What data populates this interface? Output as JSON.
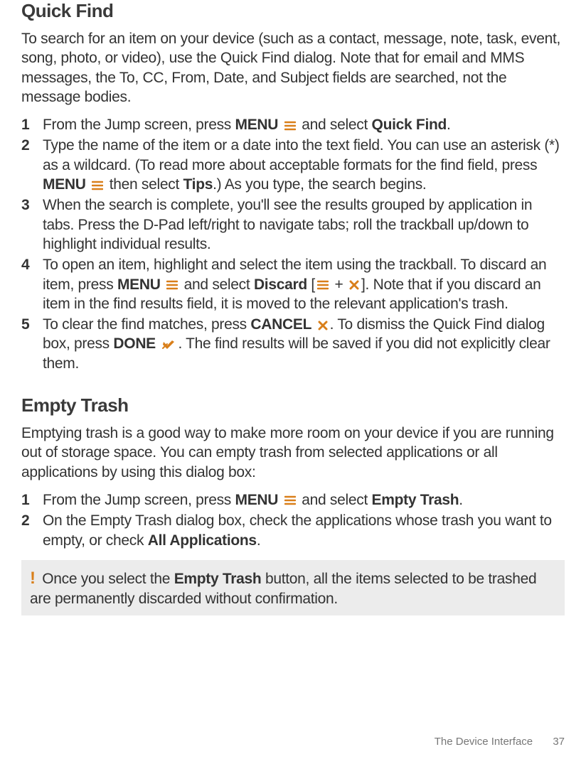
{
  "section1": {
    "title": "Quick Find",
    "intro": "To search for an item on your device (such as a contact, message, note, task, event, song, photo, or video), use the Quick Find dialog. Note that for email and MMS messages, the To, CC, From, Date, and Subject fields are searched, not the message bodies.",
    "steps": {
      "s1a": "From the Jump screen, press ",
      "s1b": "MENU",
      "s1c": " and select ",
      "s1d": "Quick Find",
      "s1e": ".",
      "s2a": "Type the name of the item or a date into the text field. You can use an asterisk (*) as a wildcard. (To read more about acceptable formats for the find field, press ",
      "s2b": "MENU",
      "s2c": " then select ",
      "s2d": "Tips",
      "s2e": ".) As you type, the search begins.",
      "s3": "When the search is complete, you'll see the results grouped by application in tabs. Press the D-Pad left/right to navigate tabs; roll the trackball up/down to highlight individual results.",
      "s4a": "To open an item, highlight and select the item using the trackball. To discard an item, press ",
      "s4b": "MENU",
      "s4c": " and select ",
      "s4d": "Discard",
      "s4e": " [",
      "s4f": " + ",
      "s4g": "]. Note that if you discard an item in the find results field, it is moved to the relevant application's trash.",
      "s5a": "To clear the find matches, press ",
      "s5b": "CANCEL",
      "s5c": ". To dismiss the Quick Find dialog box, press  ",
      "s5d": "DONE",
      "s5e": ". The find results will be saved if you did not explicitly clear them."
    }
  },
  "section2": {
    "title": "Empty Trash",
    "intro": "Emptying trash is a good way to make more room on your device if you are running out of storage space. You can empty trash from selected applications or all applications by using this dialog box:",
    "steps": {
      "s1a": "From the Jump screen, press ",
      "s1b": "MENU",
      "s1c": " and select ",
      "s1d": "Empty Trash",
      "s1e": ".",
      "s2a": "On the Empty Trash dialog box, check the applications whose trash you want to empty, or check ",
      "s2b": "All Applications",
      "s2c": "."
    },
    "warning": {
      "exclaim": "!",
      "a": "  Once you select the ",
      "b": "Empty Trash",
      "c": " button, all the items selected to be trashed are permanently discarded without confirmation."
    }
  },
  "footer": {
    "chapter": "The Device Interface",
    "page": "37"
  }
}
